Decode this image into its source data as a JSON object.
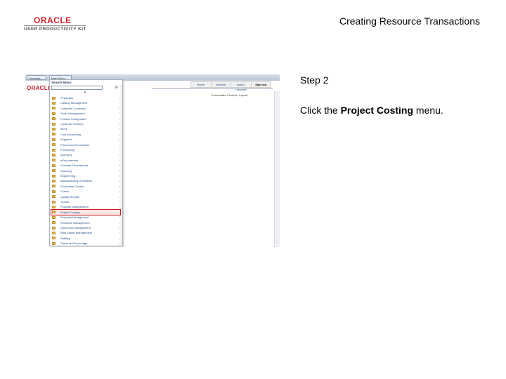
{
  "header": {
    "logo_brand": "ORACLE",
    "logo_sub": "USER PRODUCTIVITY KIT",
    "title": "Creating Resource Transactions"
  },
  "screenshot": {
    "topbar": {
      "favorites": "Favorites",
      "main_menu": "Main Menu"
    },
    "app_logo": "ORACLE",
    "nav": [
      "Home",
      "Worklist",
      "Add to Favorites",
      "Sign out"
    ],
    "personalize": "Personalize Content | Layout",
    "menu": {
      "search_label": "Search Menu:",
      "search_value": "",
      "items": [
        {
          "label": "Financials",
          "arrow": "›"
        },
        {
          "label": "Catalog Management",
          "arrow": "›"
        },
        {
          "label": "Customer Contracts",
          "arrow": "›"
        },
        {
          "label": "Order Management",
          "arrow": "›"
        },
        {
          "label": "Product Configurator",
          "arrow": "›"
        },
        {
          "label": "Customer Returns",
          "arrow": "›"
        },
        {
          "label": "Items",
          "arrow": "›"
        },
        {
          "label": "Cost Accounting",
          "arrow": "›"
        },
        {
          "label": "Suppliers",
          "arrow": "›"
        },
        {
          "label": "Procurement Contracts",
          "arrow": "›"
        },
        {
          "label": "Purchasing",
          "arrow": "›"
        },
        {
          "label": "Inventory",
          "arrow": "›"
        },
        {
          "label": "eProcurement",
          "arrow": "›"
        },
        {
          "label": "Contract Procurement",
          "arrow": "›"
        },
        {
          "label": "Sourcing",
          "arrow": "›"
        },
        {
          "label": "Engineering",
          "arrow": "›"
        },
        {
          "label": "Manufacturing Definitions",
          "arrow": "›"
        },
        {
          "label": "Production Control",
          "arrow": "›"
        },
        {
          "label": "Grants",
          "arrow": "›"
        },
        {
          "label": "Quality Results",
          "arrow": "›"
        },
        {
          "label": "Grants",
          "arrow": "›"
        },
        {
          "label": "Program Management",
          "arrow": "›"
        },
        {
          "label": "Project Costing",
          "arrow": "›"
        },
        {
          "label": "Proposal Management",
          "arrow": "›"
        },
        {
          "label": "Resource Management",
          "arrow": "›"
        },
        {
          "label": "Document Management",
          "arrow": "›"
        },
        {
          "label": "Real Estate Management",
          "arrow": "›"
        },
        {
          "label": "Staffing",
          "arrow": "›"
        },
        {
          "label": "Travel and Expenses",
          "arrow": "›"
        }
      ],
      "highlighted_index": 22
    }
  },
  "step": {
    "title": "Step 2",
    "instruction_prefix": "Click the ",
    "instruction_target": "Project Costing",
    "instruction_suffix": " menu."
  },
  "colors": {
    "highlight": "#d01418",
    "brand": "#d2232a"
  }
}
